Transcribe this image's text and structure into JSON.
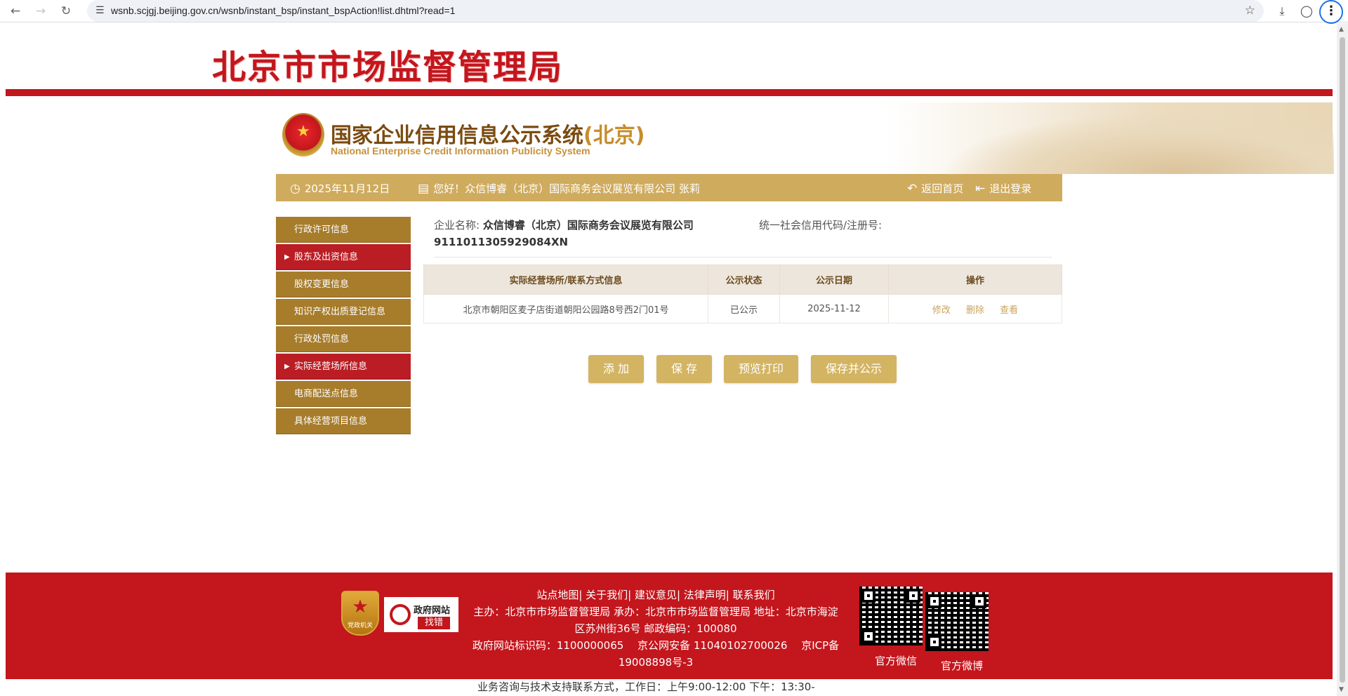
{
  "browser": {
    "url": "wsnb.scjgj.beijing.gov.cn/wsnb/instant_bsp/instant_bspAction!list.dhtml?read=1"
  },
  "header": {
    "bureau_title": "北京市市场监督管理局",
    "system_title_main": "国家企业信用信息公示系统",
    "system_title_region": "(北京)",
    "system_subtitle": "National Enterprise Credit Information Publicity System"
  },
  "infobar": {
    "date": "2025年11月12日",
    "greeting": "您好！众信博睿（北京）国际商务会议展览有限公司 张莉",
    "home_label": "返回首页",
    "logout_label": "退出登录"
  },
  "sidebar": {
    "items": [
      {
        "label": "行政许可信息",
        "active": false
      },
      {
        "label": "股东及出资信息",
        "active": true
      },
      {
        "label": "股权变更信息",
        "active": false
      },
      {
        "label": "知识产权出质登记信息",
        "active": false
      },
      {
        "label": "行政处罚信息",
        "active": false
      },
      {
        "label": "实际经营场所信息",
        "active": true
      },
      {
        "label": "电商配送点信息",
        "active": false
      },
      {
        "label": "具体经营项目信息",
        "active": false
      }
    ]
  },
  "company": {
    "name_label": "企业名称:",
    "name_value": "众信博睿（北京）国际商务会议展览有限公司",
    "code_label": "统一社会信用代码/注册号:",
    "code_value": "9111011305929084XN"
  },
  "table": {
    "headers": [
      "实际经营场所/联系方式信息",
      "公示状态",
      "公示日期",
      "操作"
    ],
    "rows": [
      {
        "address": "北京市朝阳区麦子店街道朝阳公园路8号西2门01号",
        "status": "已公示",
        "date": "2025-11-12",
        "actions": [
          "修改",
          "删除",
          "查看"
        ]
      }
    ]
  },
  "buttons": {
    "add": "添 加",
    "save": "保 存",
    "preview": "预览打印",
    "save_publish": "保存并公示"
  },
  "footer": {
    "badge_party": "党政机关",
    "badge_gov_line1": "政府网站",
    "badge_gov_line2": "找错",
    "links": "站点地图| 关于我们| 建议意见| 法律声明| 联系我们",
    "host_line": "主办：北京市市场监督管理局 承办：北京市市场监督管理局 地址：北京市海淀区苏州街36号 邮政编码：100080",
    "id_line": "政府网站标识码：1100000065　 京公网安备 11040102700026　 京ICP备19008898号-3",
    "wechat_label": "官方微信",
    "weibo_label": "官方微博",
    "support_line": "业务咨询与技术支持联系方式，工作日：上午9:00-12:00 下午：13:30-"
  },
  "colors": {
    "brand_red": "#c3161d",
    "gold_bar": "#cfab5e",
    "sidebar_brown": "#a77c2b",
    "button_gold": "#d3b463"
  }
}
